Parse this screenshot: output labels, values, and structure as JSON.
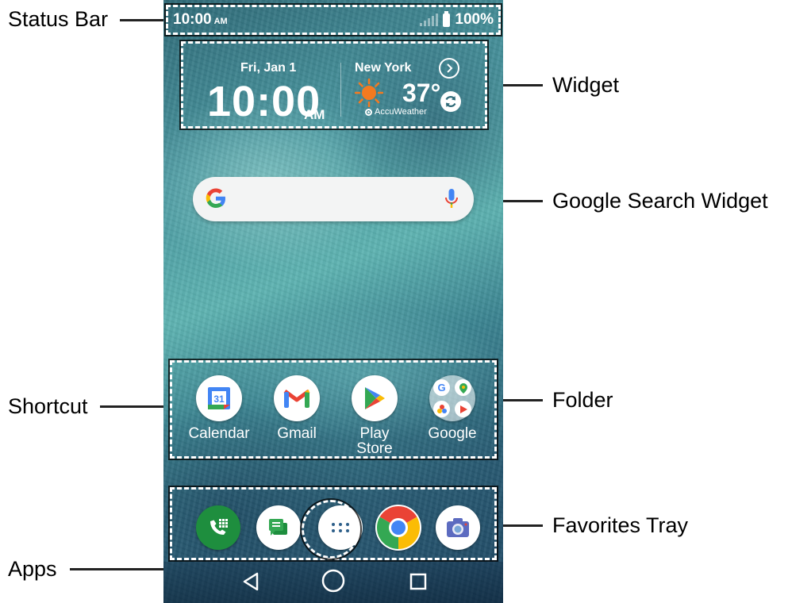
{
  "callouts": {
    "status_bar": "Status Bar",
    "widget": "Widget",
    "google_search_widget": "Google Search Widget",
    "shortcut": "Shortcut",
    "folder": "Folder",
    "favorites_tray": "Favorites Tray",
    "apps": "Apps"
  },
  "status_bar": {
    "time": "10:00",
    "ampm": "AM",
    "battery": "100%"
  },
  "widget": {
    "date": "Fri, Jan 1",
    "clock": "10:00",
    "clock_ampm": "AM",
    "city": "New York",
    "temperature": "37°",
    "provider": "AccuWeather"
  },
  "shortcuts": [
    {
      "label": "Calendar",
      "icon": "calendar-icon"
    },
    {
      "label": "Gmail",
      "icon": "gmail-icon"
    },
    {
      "label": "Play Store",
      "icon": "play-store-icon"
    },
    {
      "label": "Google",
      "icon": "folder-icon"
    }
  ],
  "calendar_day": "31",
  "favorites": [
    "phone-icon",
    "messages-icon",
    "apps-icon",
    "chrome-icon",
    "camera-icon"
  ],
  "navigation": [
    "back-icon",
    "home-icon",
    "recents-icon"
  ],
  "colors": {
    "google_blue": "#4285F4",
    "google_red": "#EA4335",
    "google_yellow": "#FBBC05",
    "google_green": "#34A853",
    "phone_green": "#1e8e3e",
    "sun_orange": "#f47a20"
  }
}
